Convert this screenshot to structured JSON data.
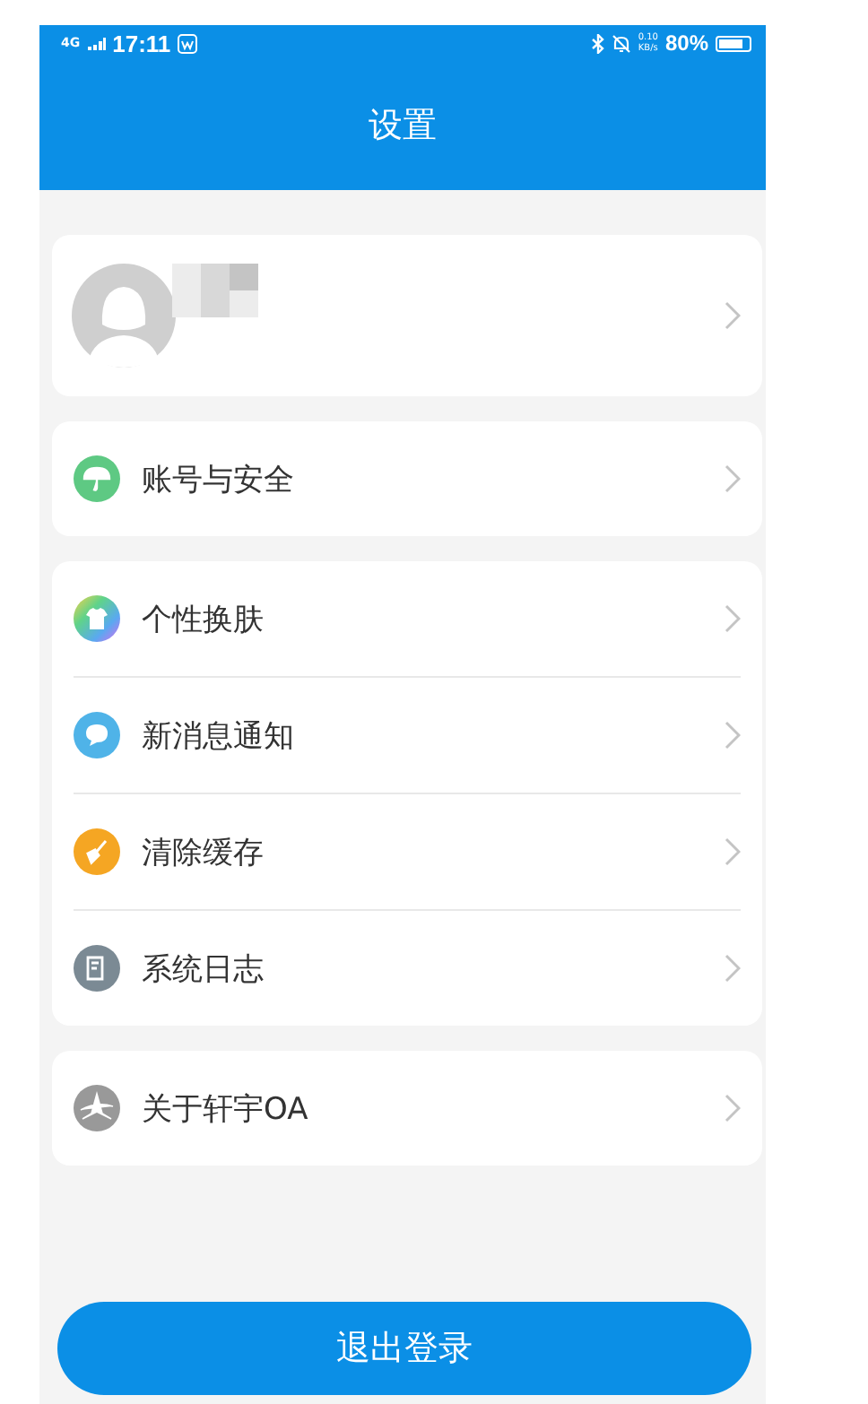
{
  "status_bar": {
    "network": "4G",
    "time": "17:11",
    "speed_value": "0.10",
    "speed_unit": "KB/s",
    "battery": "80%"
  },
  "header": {
    "title": "设置"
  },
  "profile": {
    "kind": "avatar"
  },
  "groups": [
    {
      "items": [
        {
          "label": "账号与安全",
          "kind": "umbrella",
          "color": "#5ec983"
        }
      ]
    },
    {
      "items": [
        {
          "label": "个性换肤",
          "kind": "shirt"
        },
        {
          "label": "新消息通知",
          "kind": "chat",
          "color": "#4fb3e8"
        },
        {
          "label": "清除缓存",
          "kind": "broom",
          "color": "#f5a623"
        },
        {
          "label": "系统日志",
          "kind": "log",
          "color": "#7b8a94"
        }
      ]
    },
    {
      "items": [
        {
          "label": "关于轩宇OA",
          "kind": "star",
          "color": "#999999"
        }
      ]
    }
  ],
  "logout_button": "退出登录"
}
